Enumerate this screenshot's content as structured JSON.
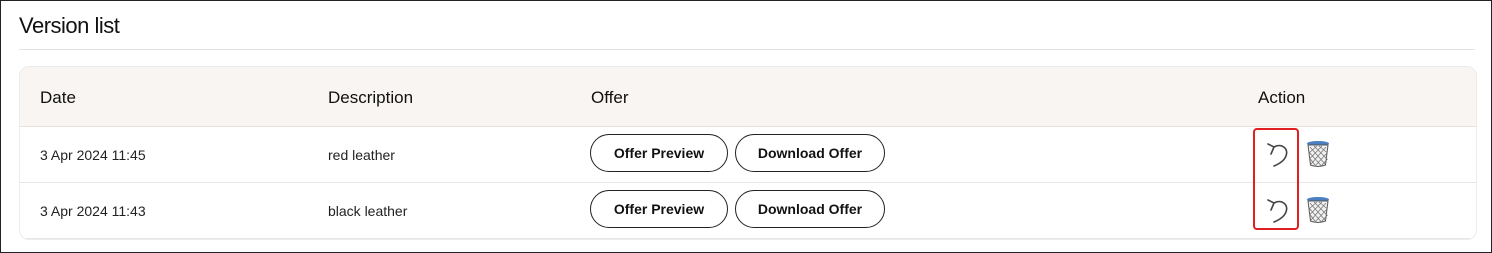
{
  "header": {
    "title": "Version list"
  },
  "table": {
    "columns": {
      "date": "Date",
      "description": "Description",
      "offer": "Offer",
      "action": "Action"
    },
    "rows": [
      {
        "date": "3 Apr 2024 11:45",
        "description": "red leather",
        "preview_label": "Offer Preview",
        "download_label": "Download Offer",
        "actions": [
          "undo-icon",
          "trash-icon"
        ]
      },
      {
        "date": "3 Apr 2024 11:43",
        "description": "black leather",
        "preview_label": "Offer Preview",
        "download_label": "Download Offer",
        "actions": [
          "undo-icon",
          "trash-icon"
        ]
      }
    ]
  },
  "colors": {
    "header_bg": "#f8f5f2",
    "highlight": "#e02020",
    "trash_rim": "#4a7fc1"
  }
}
